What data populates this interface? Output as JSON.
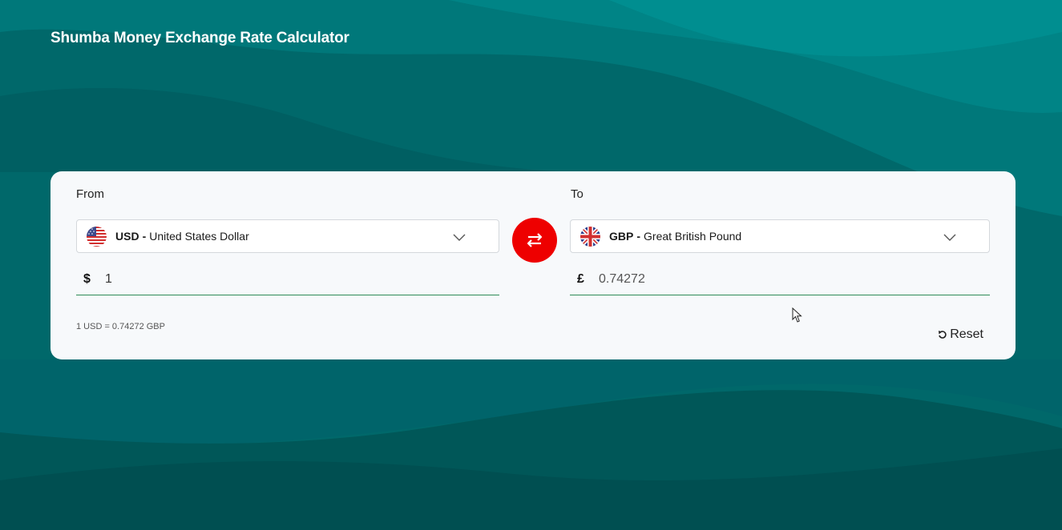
{
  "header": {
    "title": "Shumba Money Exchange Rate Calculator"
  },
  "colors": {
    "background": "#006b6b",
    "card": "#f7f9fb",
    "accent_red": "#ee0000",
    "underline_green": "#2e8b57"
  },
  "converter": {
    "from": {
      "label": "From",
      "currency_code": "USD",
      "separator": "-",
      "currency_name": "United States Dollar",
      "flag_icon": "us-flag-icon",
      "symbol": "$",
      "amount": "1"
    },
    "to": {
      "label": "To",
      "currency_code": "GBP",
      "separator": "-",
      "currency_name": "Great British Pound",
      "flag_icon": "uk-flag-icon",
      "symbol": "£",
      "amount": "0.74272"
    },
    "swap_icon": "swap-arrows-icon",
    "rate_text": "1 USD = 0.74272 GBP",
    "reset_label": "Reset",
    "reset_icon": "reset-icon"
  }
}
